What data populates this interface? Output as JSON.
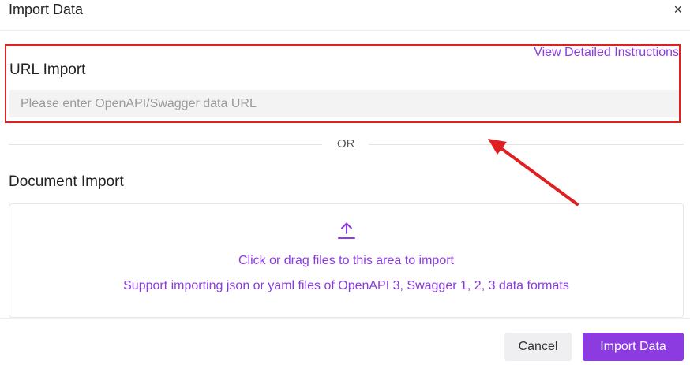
{
  "dialog": {
    "title": "Import Data",
    "close_symbol": "×"
  },
  "url_import": {
    "title": "URL Import",
    "instructions_link": "View Detailed Instructions",
    "placeholder": "Please enter OpenAPI/Swagger data URL",
    "value": ""
  },
  "divider": {
    "text": "OR"
  },
  "document_import": {
    "title": "Document Import",
    "upload_icon": "upload-icon",
    "main_text": "Click or drag files to this area to import",
    "sub_text": "Support importing json or yaml files of OpenAPI 3, Swagger 1, 2, 3 data formats"
  },
  "footer": {
    "cancel_label": "Cancel",
    "import_label": "Import Data"
  },
  "colors": {
    "accent": "#8b3be0",
    "highlight_box": "#e02020",
    "arrow": "#e02020"
  }
}
